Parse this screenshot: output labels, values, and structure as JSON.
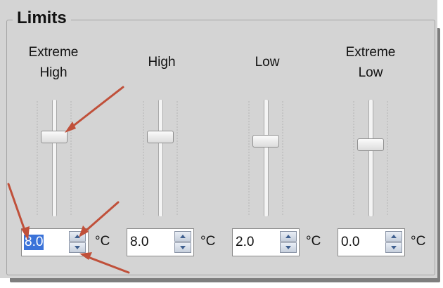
{
  "group": {
    "title": "Limits"
  },
  "sliders": [
    {
      "label_lines": [
        "Extreme",
        "High"
      ],
      "value": "8.0",
      "unit": "°C",
      "level": 0.68,
      "selected": true
    },
    {
      "label_lines": [
        "High"
      ],
      "value": "8.0",
      "unit": "°C",
      "level": 0.68,
      "selected": false
    },
    {
      "label_lines": [
        "Low"
      ],
      "value": "2.0",
      "unit": "°C",
      "level": 0.6,
      "selected": false
    },
    {
      "label_lines": [
        "Extreme",
        "Low"
      ],
      "value": "0.0",
      "unit": "°C",
      "level": 0.56,
      "selected": false
    }
  ],
  "colors": {
    "annotation_arrow": "#c0503a",
    "selection": "#3b73d9",
    "panel": "#d4d4d4"
  }
}
